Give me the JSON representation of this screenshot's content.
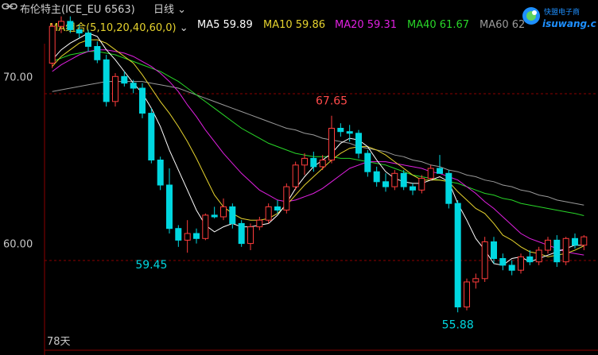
{
  "header": {
    "instrument": "布伦特主(ICE_EU 6563)",
    "period": "日线",
    "period_caret": "⌄"
  },
  "ma_bar": {
    "group": "MA组合(5,10,20,40,60,0)",
    "caret": "⌄",
    "ma5": "MA5 59.89",
    "ma10": "MA10 59.86",
    "ma20": "MA20 59.31",
    "ma40": "MA40 61.67",
    "ma60": "MA60 62"
  },
  "logo": {
    "text_cn": "快盟电子商",
    "text_en": "isuwang.com"
  },
  "colors": {
    "up": "#ff3c3c",
    "down": "#00d7e0",
    "ma5": "#ffffff",
    "ma10": "#e6d32e",
    "ma20": "#e020e0",
    "ma40": "#28d628",
    "ma60": "#9a9a9a",
    "grid": "#8b0000"
  },
  "chart_data": {
    "type": "candlestick",
    "y_ticks": [
      {
        "value": 70,
        "label": "70.00"
      },
      {
        "value": 60,
        "label": "60.00"
      }
    ],
    "ylim": [
      53.8,
      74.2
    ],
    "annotations": [
      {
        "label": "67.65",
        "value": 67.65,
        "index": 31,
        "color": "#ff4a4a"
      },
      {
        "label": "59.45",
        "value": 59.45,
        "index": 11,
        "color": "#00d7e0"
      },
      {
        "label": "55.88",
        "value": 55.88,
        "index": 45,
        "color": "#00d7e0"
      }
    ],
    "footer_label": "78天",
    "candles": [
      [
        70.8,
        73.2,
        70.5,
        73.0
      ],
      [
        73.0,
        73.6,
        72.6,
        73.3
      ],
      [
        73.3,
        73.6,
        72.6,
        72.8
      ],
      [
        72.8,
        73.1,
        72.3,
        72.6
      ],
      [
        72.6,
        72.8,
        71.5,
        71.8
      ],
      [
        71.8,
        72.1,
        70.8,
        71.0
      ],
      [
        71.0,
        71.3,
        68.2,
        68.5
      ],
      [
        68.5,
        70.2,
        68.2,
        70.0
      ],
      [
        70.0,
        70.3,
        69.4,
        69.6
      ],
      [
        69.6,
        69.8,
        69.0,
        69.3
      ],
      [
        69.3,
        69.6,
        67.5,
        67.8
      ],
      [
        67.8,
        68.1,
        64.8,
        65.0
      ],
      [
        65.0,
        65.2,
        63.2,
        63.5
      ],
      [
        63.5,
        64.5,
        60.6,
        60.9
      ],
      [
        60.9,
        61.1,
        59.8,
        60.2
      ],
      [
        60.2,
        61.4,
        59.45,
        60.6
      ],
      [
        60.6,
        60.9,
        60.0,
        60.3
      ],
      [
        60.3,
        61.8,
        60.2,
        61.7
      ],
      [
        61.7,
        62.2,
        61.5,
        61.6
      ],
      [
        61.6,
        62.7,
        61.4,
        62.2
      ],
      [
        62.2,
        62.4,
        60.9,
        61.2
      ],
      [
        61.2,
        61.4,
        59.8,
        60.0
      ],
      [
        60.0,
        61.2,
        59.6,
        61.0
      ],
      [
        61.0,
        61.6,
        60.8,
        61.4
      ],
      [
        61.4,
        62.4,
        61.2,
        62.2
      ],
      [
        62.2,
        62.6,
        61.8,
        62.0
      ],
      [
        62.0,
        63.6,
        61.8,
        63.4
      ],
      [
        63.4,
        64.9,
        63.2,
        64.7
      ],
      [
        64.7,
        65.4,
        64.1,
        65.1
      ],
      [
        65.1,
        65.5,
        64.3,
        64.6
      ],
      [
        64.6,
        65.3,
        64.4,
        65.0
      ],
      [
        65.0,
        67.65,
        64.8,
        66.9
      ],
      [
        66.9,
        67.2,
        66.4,
        66.7
      ],
      [
        66.7,
        67.1,
        66.1,
        66.6
      ],
      [
        66.6,
        66.8,
        65.1,
        65.4
      ],
      [
        65.4,
        65.6,
        64.0,
        64.3
      ],
      [
        64.3,
        64.6,
        63.4,
        63.7
      ],
      [
        63.7,
        64.2,
        63.1,
        63.4
      ],
      [
        63.4,
        64.4,
        63.2,
        64.2
      ],
      [
        64.2,
        64.4,
        63.2,
        63.4
      ],
      [
        63.4,
        63.6,
        62.9,
        63.2
      ],
      [
        63.2,
        64.1,
        63.0,
        63.9
      ],
      [
        63.9,
        64.7,
        63.8,
        64.5
      ],
      [
        64.5,
        65.3,
        64.2,
        64.2
      ],
      [
        64.2,
        64.4,
        62.1,
        62.4
      ],
      [
        62.4,
        62.6,
        55.88,
        56.2
      ],
      [
        56.2,
        57.9,
        56.0,
        57.7
      ],
      [
        57.7,
        58.2,
        57.3,
        57.9
      ],
      [
        57.9,
        60.4,
        57.7,
        60.1
      ],
      [
        60.1,
        60.4,
        58.8,
        59.1
      ],
      [
        59.1,
        59.4,
        58.4,
        58.7
      ],
      [
        58.7,
        59.0,
        58.1,
        58.4
      ],
      [
        58.4,
        59.4,
        58.2,
        59.2
      ],
      [
        59.2,
        59.6,
        58.7,
        58.9
      ],
      [
        58.9,
        59.8,
        58.7,
        59.6
      ],
      [
        59.6,
        60.4,
        59.4,
        60.2
      ],
      [
        60.2,
        60.5,
        58.6,
        58.9
      ],
      [
        58.9,
        60.4,
        58.7,
        60.3
      ],
      [
        60.3,
        60.6,
        59.7,
        59.9
      ],
      [
        59.9,
        60.5,
        59.6,
        60.4
      ]
    ],
    "ma": {
      "ma5": [
        71.0,
        71.6,
        72.0,
        72.3,
        72.6,
        72.4,
        71.6,
        71.0,
        70.3,
        69.6,
        69.0,
        68.1,
        67.0,
        65.6,
        64.4,
        63.2,
        62.0,
        61.1,
        60.7,
        61.0,
        61.2,
        61.0,
        61.0,
        61.1,
        61.2,
        61.7,
        62.4,
        63.3,
        64.0,
        64.6,
        65.0,
        65.4,
        66.0,
        66.3,
        66.2,
        65.8,
        65.0,
        64.3,
        63.9,
        63.7,
        63.6,
        63.6,
        63.8,
        64.0,
        63.7,
        62.4,
        61.4,
        60.3,
        59.6,
        58.8,
        58.7,
        59.1,
        59.2,
        58.9,
        59.1,
        59.3,
        59.5,
        59.7,
        59.9,
        59.89
      ],
      "ma10": [
        70.6,
        71.2,
        71.6,
        72.0,
        72.2,
        72.2,
        72.0,
        71.6,
        71.2,
        70.8,
        70.1,
        69.3,
        68.5,
        67.8,
        67.0,
        66.1,
        65.1,
        64.0,
        62.9,
        62.2,
        61.8,
        61.5,
        61.4,
        61.4,
        61.5,
        61.8,
        62.3,
        62.9,
        63.5,
        64.0,
        64.5,
        65.0,
        65.4,
        65.7,
        65.8,
        65.8,
        65.6,
        65.3,
        64.9,
        64.5,
        64.1,
        63.8,
        63.8,
        63.8,
        63.7,
        63.1,
        62.6,
        62.1,
        61.8,
        61.2,
        60.5,
        60.2,
        59.8,
        59.5,
        59.4,
        59.2,
        59.3,
        59.4,
        59.6,
        59.86
      ],
      "ma20": [
        70.3,
        70.7,
        71.0,
        71.3,
        71.5,
        71.6,
        71.6,
        71.5,
        71.4,
        71.2,
        70.9,
        70.6,
        70.2,
        69.7,
        69.1,
        68.3,
        67.6,
        66.8,
        66.1,
        65.4,
        64.8,
        64.2,
        63.7,
        63.2,
        62.9,
        62.6,
        62.5,
        62.6,
        62.8,
        63.0,
        63.3,
        63.7,
        64.1,
        64.5,
        64.7,
        64.9,
        64.9,
        64.9,
        64.8,
        64.7,
        64.6,
        64.5,
        64.3,
        64.2,
        64.0,
        63.8,
        63.4,
        63.0,
        62.5,
        62.1,
        61.6,
        61.1,
        60.6,
        60.3,
        60.1,
        59.9,
        59.7,
        59.5,
        59.4,
        59.31
      ],
      "ma40": [
        70.9,
        71.1,
        71.3,
        71.4,
        71.5,
        71.5,
        71.4,
        71.3,
        71.1,
        70.9,
        70.7,
        70.5,
        70.3,
        70.0,
        69.7,
        69.3,
        68.9,
        68.5,
        68.1,
        67.7,
        67.3,
        66.9,
        66.6,
        66.3,
        66.0,
        65.8,
        65.6,
        65.4,
        65.3,
        65.2,
        65.2,
        65.2,
        65.1,
        65.1,
        65.0,
        64.9,
        64.8,
        64.7,
        64.5,
        64.3,
        64.1,
        64.0,
        63.9,
        63.8,
        63.7,
        63.6,
        63.4,
        63.2,
        63.0,
        62.9,
        62.7,
        62.6,
        62.4,
        62.3,
        62.2,
        62.1,
        62.0,
        61.9,
        61.8,
        61.67
      ],
      "ma60": [
        69.1,
        69.2,
        69.3,
        69.4,
        69.5,
        69.6,
        69.7,
        69.7,
        69.7,
        69.7,
        69.7,
        69.6,
        69.5,
        69.4,
        69.3,
        69.1,
        68.9,
        68.7,
        68.5,
        68.3,
        68.1,
        67.9,
        67.7,
        67.5,
        67.3,
        67.1,
        66.9,
        66.8,
        66.6,
        66.5,
        66.3,
        66.2,
        66.1,
        66.0,
        65.8,
        65.7,
        65.6,
        65.5,
        65.3,
        65.2,
        65.0,
        64.9,
        64.7,
        64.6,
        64.4,
        64.3,
        64.1,
        64.0,
        63.8,
        63.7,
        63.5,
        63.4,
        63.2,
        63.1,
        62.9,
        62.8,
        62.6,
        62.5,
        62.4,
        62.3
      ]
    }
  }
}
